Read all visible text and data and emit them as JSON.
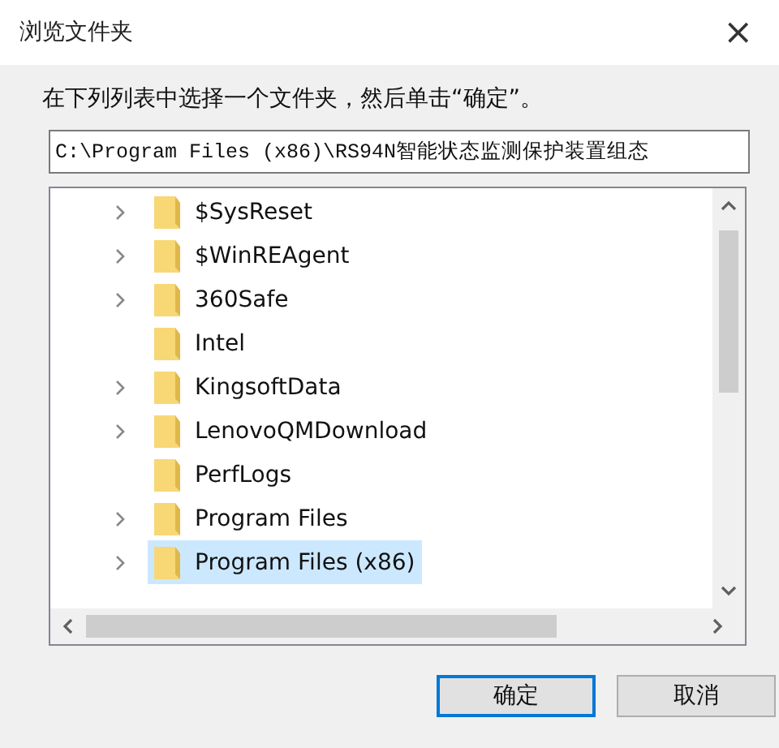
{
  "window": {
    "title": "浏览文件夹",
    "close": "×"
  },
  "instruction": "在下列列表中选择一个文件夹，然后单击“确定”。",
  "path_field": {
    "value": "C:\\Program Files (x86)\\RS94N智能状态监测保护装置组态"
  },
  "tree": {
    "items": [
      {
        "label": "$SysReset",
        "expandable": true,
        "selected": false
      },
      {
        "label": "$WinREAgent",
        "expandable": true,
        "selected": false
      },
      {
        "label": "360Safe",
        "expandable": true,
        "selected": false
      },
      {
        "label": "Intel",
        "expandable": false,
        "selected": false
      },
      {
        "label": "KingsoftData",
        "expandable": true,
        "selected": false
      },
      {
        "label": "LenovoQMDownload",
        "expandable": true,
        "selected": false
      },
      {
        "label": "PerfLogs",
        "expandable": false,
        "selected": false
      },
      {
        "label": "Program Files",
        "expandable": true,
        "selected": false
      },
      {
        "label": "Program Files (x86)",
        "expandable": true,
        "selected": true
      }
    ]
  },
  "buttons": [
    {
      "label": "确定",
      "default": true
    },
    {
      "label": "取消",
      "default": false
    }
  ]
}
